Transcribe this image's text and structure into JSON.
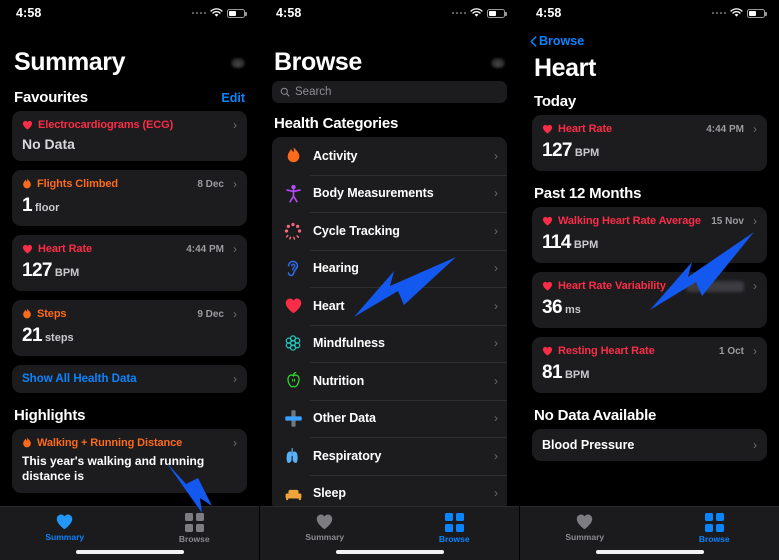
{
  "colors": {
    "accent_blue": "#0a84ff",
    "arrow_blue": "#1359ef",
    "card_bg": "#1c1c1e",
    "screen_bg": "#000000",
    "heart_red": "#fa2d48",
    "flame_orange": "#fc6a1b",
    "body_purple": "#b44bf2",
    "cycle_pink": "#f4687a",
    "hearing_blue": "#2f6bea",
    "mind_teal": "#24c8bd",
    "nutrition_green": "#2fd92f",
    "other_blue": "#3ca0ff",
    "resp_blue": "#5ab0f7",
    "sleep_orange": "#f0a53a"
  },
  "status_bar": {
    "time": "4:58"
  },
  "panel_summary": {
    "title": "Summary",
    "sections": [
      {
        "heading": "Favourites",
        "action": "Edit"
      },
      {
        "heading": "Highlights",
        "action": ""
      }
    ],
    "favourites": [
      {
        "icon": "heart-icon",
        "label": "Electrocardiograms (ECG)",
        "meta": "",
        "value": "",
        "unit": "",
        "nodata": "No Data",
        "color": "#fa2d48"
      },
      {
        "icon": "flame-icon",
        "label": "Flights Climbed",
        "meta": "8 Dec",
        "value": "1",
        "unit": "floor",
        "nodata": "",
        "color": "#fc6a1b"
      },
      {
        "icon": "heart-icon",
        "label": "Heart Rate",
        "meta": "4:44 PM",
        "value": "127",
        "unit": "BPM",
        "nodata": "",
        "color": "#fa2d48"
      },
      {
        "icon": "flame-icon",
        "label": "Steps",
        "meta": "9 Dec",
        "value": "21",
        "unit": "steps",
        "nodata": "",
        "color": "#fc6a1b"
      }
    ],
    "show_all": "Show All Health Data",
    "highlight": {
      "icon": "flame-icon",
      "label": "Walking + Running Distance",
      "color": "#fc6a1b",
      "description": "This year's walking and running distance is"
    },
    "tabs": [
      {
        "label": "Summary",
        "icon": "heart-icon",
        "active": true
      },
      {
        "label": "Browse",
        "icon": "grid-icon",
        "active": false
      }
    ]
  },
  "panel_browse": {
    "title": "Browse",
    "search_placeholder": "Search",
    "search_value": "",
    "section_heading": "Health Categories",
    "categories": [
      {
        "label": "Activity",
        "icon": "flame-icon",
        "color": "#fc6a1b"
      },
      {
        "label": "Body Measurements",
        "icon": "body-icon",
        "color": "#b44bf2"
      },
      {
        "label": "Cycle Tracking",
        "icon": "cycle-icon",
        "color": "#f4687a"
      },
      {
        "label": "Hearing",
        "icon": "ear-icon",
        "color": "#2f6bea"
      },
      {
        "label": "Heart",
        "icon": "heart-icon",
        "color": "#fa2d48"
      },
      {
        "label": "Mindfulness",
        "icon": "mindfulness-icon",
        "color": "#24c8bd"
      },
      {
        "label": "Nutrition",
        "icon": "apple-icon",
        "color": "#2fd92f"
      },
      {
        "label": "Other Data",
        "icon": "cross-icon",
        "color": "#3ca0ff"
      },
      {
        "label": "Respiratory",
        "icon": "lungs-icon",
        "color": "#5ab0f7"
      },
      {
        "label": "Sleep",
        "icon": "bed-icon",
        "color": "#f0a53a"
      }
    ],
    "tabs": [
      {
        "label": "Summary",
        "icon": "heart-icon",
        "active": false
      },
      {
        "label": "Browse",
        "icon": "grid-icon",
        "active": true
      }
    ]
  },
  "panel_heart": {
    "back_label": "Browse",
    "title": "Heart",
    "sections": [
      {
        "heading": "Today"
      },
      {
        "heading": "Past 12 Months"
      },
      {
        "heading": "No Data Available"
      }
    ],
    "today": [
      {
        "icon": "heart-icon",
        "label": "Heart Rate",
        "meta": "4:44 PM",
        "value": "127",
        "unit": "BPM",
        "redacted": false,
        "color": "#fa2d48"
      }
    ],
    "past_12_months": [
      {
        "icon": "heart-icon",
        "label": "Walking Heart Rate Average",
        "meta": "15 Nov",
        "value": "114",
        "unit": "BPM",
        "redacted": false,
        "color": "#fa2d48"
      },
      {
        "icon": "heart-icon",
        "label": "Heart Rate Variability",
        "meta": "",
        "value": "36",
        "unit": "ms",
        "redacted": true,
        "color": "#fa2d48"
      },
      {
        "icon": "heart-icon",
        "label": "Resting Heart Rate",
        "meta": "1 Oct",
        "value": "81",
        "unit": "BPM",
        "redacted": false,
        "color": "#fa2d48"
      }
    ],
    "no_data": [
      {
        "label": "Blood Pressure"
      }
    ],
    "tabs": [
      {
        "label": "Summary",
        "icon": "heart-icon",
        "active": false
      },
      {
        "label": "Browse",
        "icon": "grid-icon",
        "active": true
      }
    ]
  },
  "annotations": [
    {
      "name": "arrow-to-browse-tab",
      "color": "#1359ef"
    },
    {
      "name": "arrow-to-heart-category",
      "color": "#1359ef"
    },
    {
      "name": "arrow-to-heart-rate-variability",
      "color": "#1359ef"
    }
  ]
}
